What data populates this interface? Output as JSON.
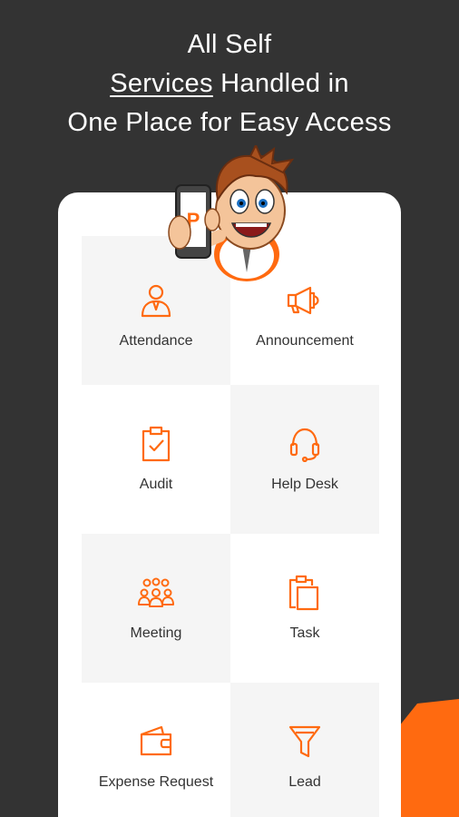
{
  "headline": {
    "line1": "All Self",
    "line2_underlined": "Services",
    "line2_rest": " Handled in",
    "line3": "One Place for Easy Access"
  },
  "colors": {
    "background": "#333333",
    "accent": "#ff6a10",
    "card": "#ffffff",
    "tile_alt": "#f5f5f5"
  },
  "mascot": {
    "phone_letter": "P",
    "icon": "mascot-holding-phone-icon"
  },
  "modules": [
    {
      "label": "Attendance",
      "icon": "person-icon"
    },
    {
      "label": "Announcement",
      "icon": "megaphone-icon"
    },
    {
      "label": "Audit",
      "icon": "clipboard-check-icon"
    },
    {
      "label": "Help Desk",
      "icon": "headset-icon"
    },
    {
      "label": "Meeting",
      "icon": "group-icon"
    },
    {
      "label": "Task",
      "icon": "clipboard-copy-icon"
    },
    {
      "label": "Expense Request",
      "icon": "wallet-icon"
    },
    {
      "label": "Lead",
      "icon": "funnel-icon"
    }
  ]
}
